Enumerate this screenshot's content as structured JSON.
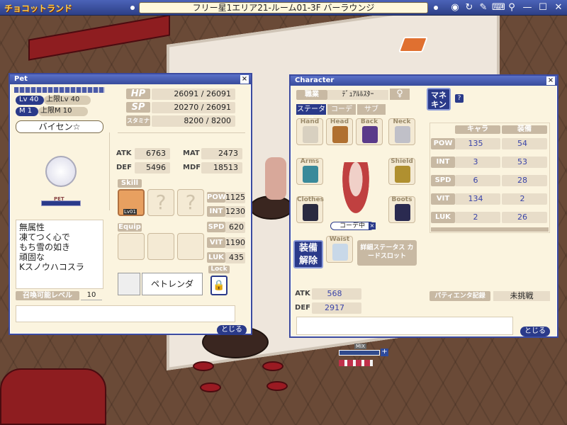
{
  "app": {
    "logo": "チョコットランド",
    "location": "フリー星1エリア21-ルーム01-3F バーラウンジ"
  },
  "pet_window": {
    "title": "Pet",
    "close": "×",
    "lv_label": "Lv 40",
    "lv_max": "上限Lv 40",
    "m_label": "M 1",
    "m_max": "上限M 10",
    "name": "バイセン☆",
    "hp_label": "HP",
    "hp": "26091 / 26091",
    "sp_label": "SP",
    "sp": "20270 / 26091",
    "stamina_label": "スタミナ",
    "stamina": "8200 / 8200",
    "atk_label": "ATK",
    "atk": "6763",
    "mat_label": "MAT",
    "mat": "2473",
    "def_label": "DEF",
    "def": "5496",
    "mdf_label": "MDF",
    "mdf": "18513",
    "skill_label": "Skill",
    "skill_lv": "Lv01",
    "unknown_slot": "?",
    "equip_label": "Equip",
    "pow_label": "POW",
    "pow": "1125",
    "int_label": "INT",
    "int": "1230",
    "spd_label": "SPD",
    "spd": "620",
    "vit_label": "VIT",
    "vit": "1190",
    "luk_label": "LUK",
    "luk": "435",
    "pet_tag": "PET",
    "description": [
      "無属性",
      "凍てつく心で",
      "もち雪の如き",
      "頑固な",
      "Kスノウハコスラ"
    ],
    "summon_label": "召喚可能レベル",
    "summon_level": "10",
    "pet_rental": "ペトレンダ",
    "lock_label": "Lock",
    "close_button": "とじる"
  },
  "character_window": {
    "title": "Character",
    "close": "×",
    "job_label": "職業",
    "job": "ﾃﾞｭｱﾙﾙｽﾀｰ",
    "gender_icon": "♀",
    "tabs": [
      "ステータス",
      "コーデ",
      "サブ"
    ],
    "mannequin": "マネキン",
    "help": "?",
    "slots": {
      "hand": "Hand",
      "head": "Head",
      "back": "Back",
      "neck": "Neck",
      "arms": "Arms",
      "shield": "Shield",
      "clothes": "Clothes",
      "boots": "Boots",
      "waist": "Waist"
    },
    "coord_label": "コーデ中",
    "unequip": "装備解除",
    "card_slot": "詳細ステータス カードスロット",
    "stat_headers": {
      "chara": "キャラ",
      "equip": "装備"
    },
    "stats": [
      {
        "name": "POW",
        "chara": "135",
        "equip": "54"
      },
      {
        "name": "INT",
        "chara": "3",
        "equip": "53"
      },
      {
        "name": "SPD",
        "chara": "6",
        "equip": "28"
      },
      {
        "name": "VIT",
        "chara": "134",
        "equip": "2"
      },
      {
        "name": "LUK",
        "chara": "2",
        "equip": "26"
      }
    ],
    "atk_label": "ATK",
    "atk": "568",
    "def_label": "DEF",
    "def": "2917",
    "party_label": "パティエンタ記録",
    "party_value": "未挑戦",
    "close_button": "とじる"
  },
  "scene": {
    "nameplate": "MIX",
    "plus": "+"
  }
}
